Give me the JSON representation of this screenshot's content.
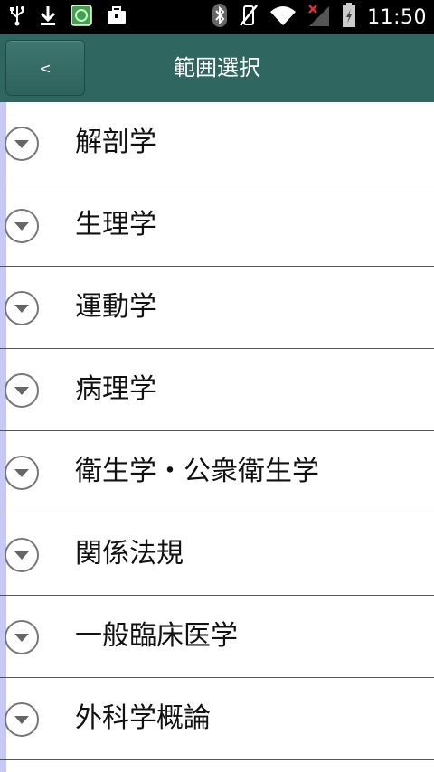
{
  "status_bar": {
    "time": "11:50",
    "left_icons": [
      "usb-icon",
      "download-icon",
      "app-notification-icon",
      "briefcase-icon"
    ],
    "right_icons": [
      "bluetooth-icon",
      "vibrate-off-icon",
      "wifi-icon",
      "signal-none-icon",
      "battery-icon"
    ]
  },
  "header": {
    "title": "範囲選択",
    "back_label": "<"
  },
  "list": {
    "items": [
      {
        "label": "解剖学"
      },
      {
        "label": "生理学"
      },
      {
        "label": "運動学"
      },
      {
        "label": "病理学"
      },
      {
        "label": "衛生学・公衆衛生学"
      },
      {
        "label": "関係法規"
      },
      {
        "label": "一般臨床医学"
      },
      {
        "label": "外科学概論"
      }
    ]
  },
  "colors": {
    "header_bg": "#2f6660",
    "accent_strip": "#c8c8f4",
    "divider": "#555555"
  }
}
